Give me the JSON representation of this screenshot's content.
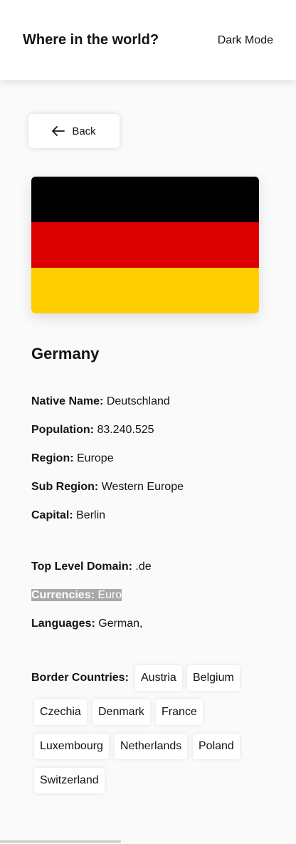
{
  "header": {
    "title": "Where in the world?",
    "mode_label": "Dark Mode"
  },
  "back_button": {
    "label": "Back",
    "icon": "arrow-left-icon"
  },
  "flag": {
    "description_colors": [
      "#000000",
      "#dd0000",
      "#ffce00"
    ]
  },
  "country": {
    "name": "Germany",
    "details": [
      {
        "label": "Native Name:",
        "value": "Deutschland"
      },
      {
        "label": "Population:",
        "value": "83.240.525"
      },
      {
        "label": "Region:",
        "value": "Europe"
      },
      {
        "label": "Sub Region:",
        "value": "Western Europe"
      },
      {
        "label": "Capital:",
        "value": "Berlin"
      }
    ],
    "extra": [
      {
        "label": "Top Level Domain:",
        "value": ".de"
      },
      {
        "label": "Currencies:",
        "value": "Euro"
      },
      {
        "label": "Languages:",
        "value": "German,"
      }
    ],
    "border_label": "Border Countries:",
    "borders": [
      "Austria",
      "Belgium",
      "Czechia",
      "Denmark",
      "France",
      "Luxembourg",
      "Netherlands",
      "Poland",
      "Switzerland"
    ]
  },
  "colors": {
    "background": "#fafafa",
    "element": "#ffffff",
    "text": "#111517",
    "selection": "#a9a9a9"
  }
}
